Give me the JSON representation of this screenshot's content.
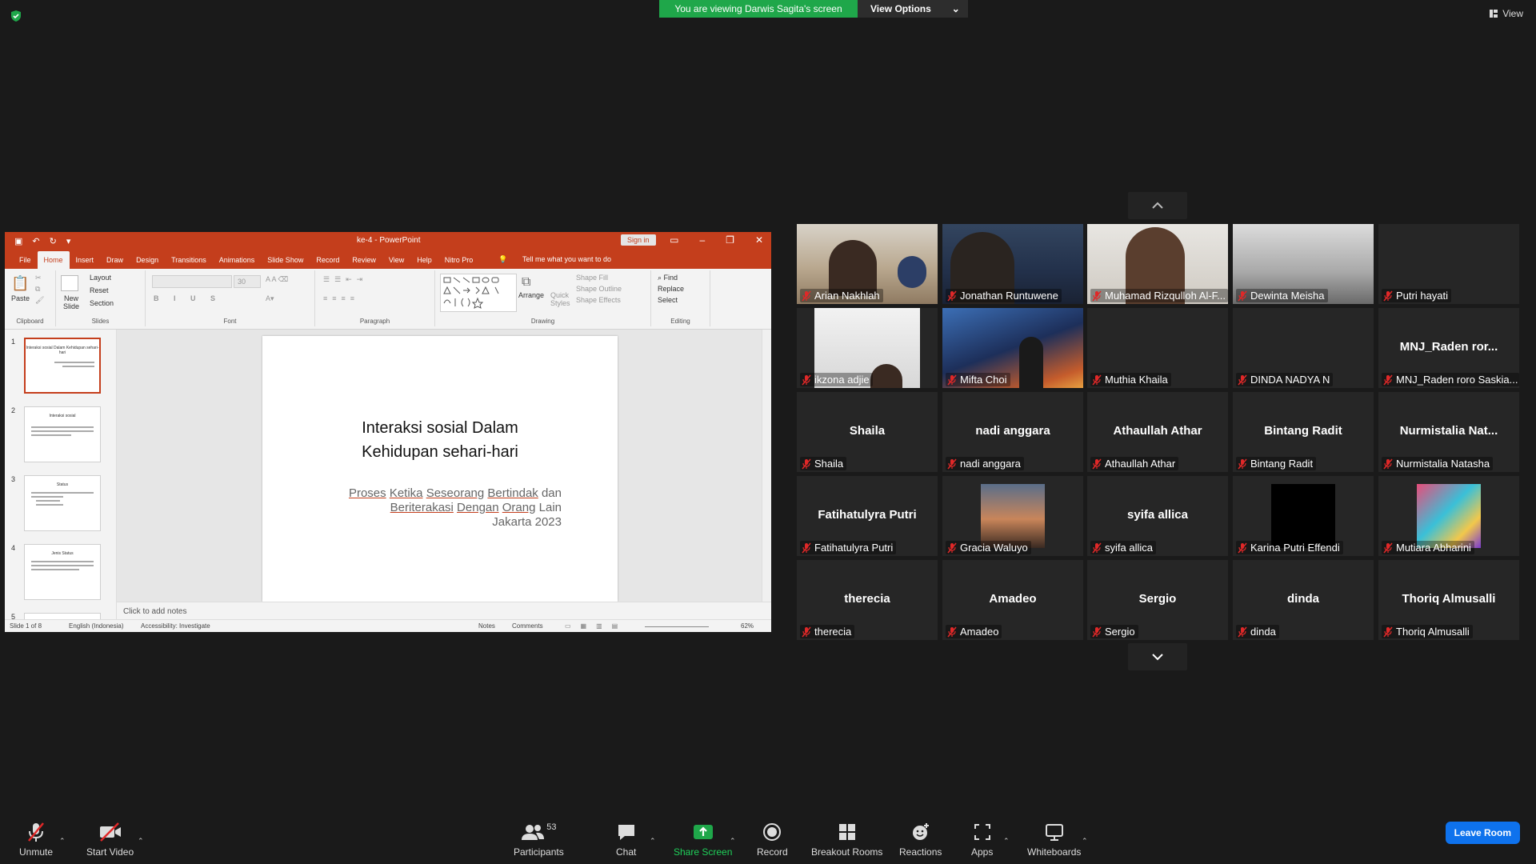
{
  "share_banner": {
    "text": "You are viewing Darwis Sagita's screen",
    "options": "View Options"
  },
  "view_label": "View",
  "ppt": {
    "doc_title": "ke-4  -  PowerPoint",
    "sign_in": "Sign in",
    "tabs": [
      "File",
      "Home",
      "Insert",
      "Draw",
      "Design",
      "Transitions",
      "Animations",
      "Slide Show",
      "Record",
      "Review",
      "View",
      "Help",
      "Nitro Pro"
    ],
    "tell_me": "Tell me what you want to do",
    "ribbon": {
      "paste": "Paste",
      "clipboard": "Clipboard",
      "new_slide": "New Slide",
      "layout": "Layout",
      "reset": "Reset",
      "section": "Section",
      "slides": "Slides",
      "font_size": "30",
      "font": "Font",
      "paragraph": "Paragraph",
      "arrange": "Arrange",
      "quick_styles": "Quick Styles",
      "shape_fill": "Shape Fill",
      "shape_outline": "Shape Outline",
      "shape_effects": "Shape Effects",
      "drawing": "Drawing",
      "find": "Find",
      "replace": "Replace",
      "select": "Select",
      "editing": "Editing"
    },
    "thumbs": [
      {
        "num": "1",
        "title": "Interaksi sosial Dalam Kehidupan sehari-hari"
      },
      {
        "num": "2",
        "title": "Interaksi sosial"
      },
      {
        "num": "3",
        "title": "Status"
      },
      {
        "num": "4",
        "title": "Jenis Status"
      },
      {
        "num": "5",
        "title": ""
      }
    ],
    "slide": {
      "title_line1": "Interaksi sosial Dalam",
      "title_line2": "Kehidupan sehari-hari",
      "sub_w1": "Proses",
      "sub_w2": "Ketika",
      "sub_w3": "Seseorang",
      "sub_w4": "Bertindak",
      "sub_w5": "dan",
      "sub2_w1": "Beriterakasi",
      "sub2_w2": "Dengan",
      "sub2_w3": "Orang",
      "sub2_w4": "Lain",
      "sub_line3": "Jakarta 2023"
    },
    "notes_placeholder": "Click to add notes",
    "status": {
      "slide": "Slide 1 of 8",
      "lang": "English (Indonesia)",
      "access": "Accessibility: Investigate",
      "notes": "Notes",
      "comments": "Comments",
      "zoom": "62%"
    }
  },
  "participants": [
    {
      "name": "Arian Nakhlah",
      "big": ""
    },
    {
      "name": "Jonathan Runtuwene",
      "big": ""
    },
    {
      "name": "Muhamad Rizqulloh Al-F...",
      "big": ""
    },
    {
      "name": "Dewinta Meisha",
      "big": ""
    },
    {
      "name": "Putri hayati",
      "big": ""
    },
    {
      "name": "ikzona adjie",
      "big": ""
    },
    {
      "name": "Mifta Choi",
      "big": ""
    },
    {
      "name": "Muthia Khaila",
      "big": ""
    },
    {
      "name": "DINDA NADYA N",
      "big": ""
    },
    {
      "name": "MNJ_Raden roro Saskia...",
      "big": "MNJ_Raden  ror..."
    },
    {
      "name": "Shaila",
      "big": "Shaila"
    },
    {
      "name": "nadi anggara",
      "big": "nadi anggara"
    },
    {
      "name": "Athaullah Athar",
      "big": "Athaullah Athar"
    },
    {
      "name": "Bintang Radit",
      "big": "Bintang Radit"
    },
    {
      "name": "Nurmistalia Natasha",
      "big": "Nurmistalia  Nat..."
    },
    {
      "name": "Fatihatulyra Putri",
      "big": "Fatihatulyra Putri"
    },
    {
      "name": "Gracia Waluyo",
      "big": ""
    },
    {
      "name": "syifa allica",
      "big": "syifa allica"
    },
    {
      "name": "Karina Putri Effendi",
      "big": ""
    },
    {
      "name": "Mutiara Abharini",
      "big": ""
    },
    {
      "name": "therecia",
      "big": "therecia"
    },
    {
      "name": "Amadeo",
      "big": "Amadeo"
    },
    {
      "name": "Sergio",
      "big": "Sergio"
    },
    {
      "name": "dinda",
      "big": "dinda"
    },
    {
      "name": "Thoriq Almusalli",
      "big": "Thoriq Almusalli"
    }
  ],
  "toolbar": {
    "unmute": "Unmute",
    "start_video": "Start Video",
    "participants": "Participants",
    "participant_count": "53",
    "chat": "Chat",
    "share_screen": "Share Screen",
    "record": "Record",
    "breakout": "Breakout Rooms",
    "reactions": "Reactions",
    "apps": "Apps",
    "whiteboards": "Whiteboards",
    "leave": "Leave Room"
  },
  "colors": {
    "zoom_green": "#1fa74a",
    "leave_blue": "#0e72ed",
    "ppt_red": "#c43e1c",
    "mic_off_red": "#e02828"
  }
}
